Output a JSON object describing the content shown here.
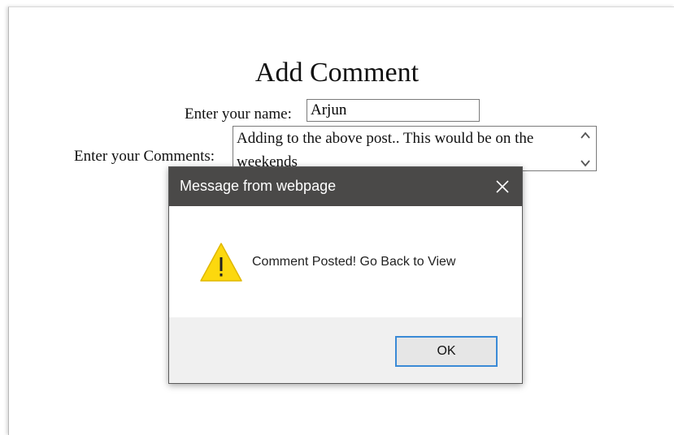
{
  "page": {
    "title": "Add Comment",
    "name_label": "Enter your name:",
    "name_value": "Arjun",
    "comments_label": "Enter your Comments:",
    "comments_value": "Adding to the above post.. This would be on the weekends"
  },
  "dialog": {
    "title": "Message from webpage",
    "message": "Comment Posted! Go Back to View",
    "ok_label": "OK",
    "icon": "warning-icon",
    "colors": {
      "titlebar": "#4a4948",
      "warning_fill": "#fcd80e",
      "ok_border": "#3a8ad6"
    }
  }
}
